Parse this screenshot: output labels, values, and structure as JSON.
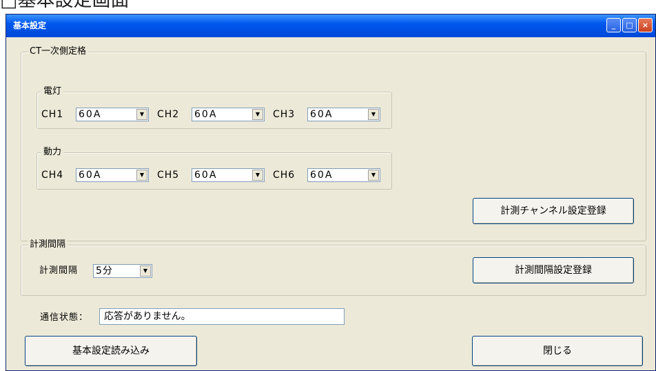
{
  "page": {
    "heading": "□基本設定画面"
  },
  "window": {
    "title": "基本設定",
    "controls": {
      "minimize": "_",
      "maximize": "□",
      "close": "×"
    }
  },
  "ct_group": {
    "legend": "CT一次側定格",
    "lighting": {
      "legend": "電灯",
      "channels": [
        {
          "label": "CH1",
          "value": "60A"
        },
        {
          "label": "CH2",
          "value": "60A"
        },
        {
          "label": "CH3",
          "value": "60A"
        }
      ]
    },
    "power": {
      "legend": "動力",
      "channels": [
        {
          "label": "CH4",
          "value": "60A"
        },
        {
          "label": "CH5",
          "value": "60A"
        },
        {
          "label": "CH6",
          "value": "60A"
        }
      ]
    },
    "register_button": "計測チャンネル設定登録"
  },
  "interval_group": {
    "legend": "計測間隔",
    "label": "計測間隔",
    "value": "5分",
    "register_button": "計測間隔設定登録"
  },
  "status": {
    "label": "通信状態：",
    "value": "応答がありません。"
  },
  "buttons": {
    "read": "基本設定読み込み",
    "close": "閉じる"
  }
}
